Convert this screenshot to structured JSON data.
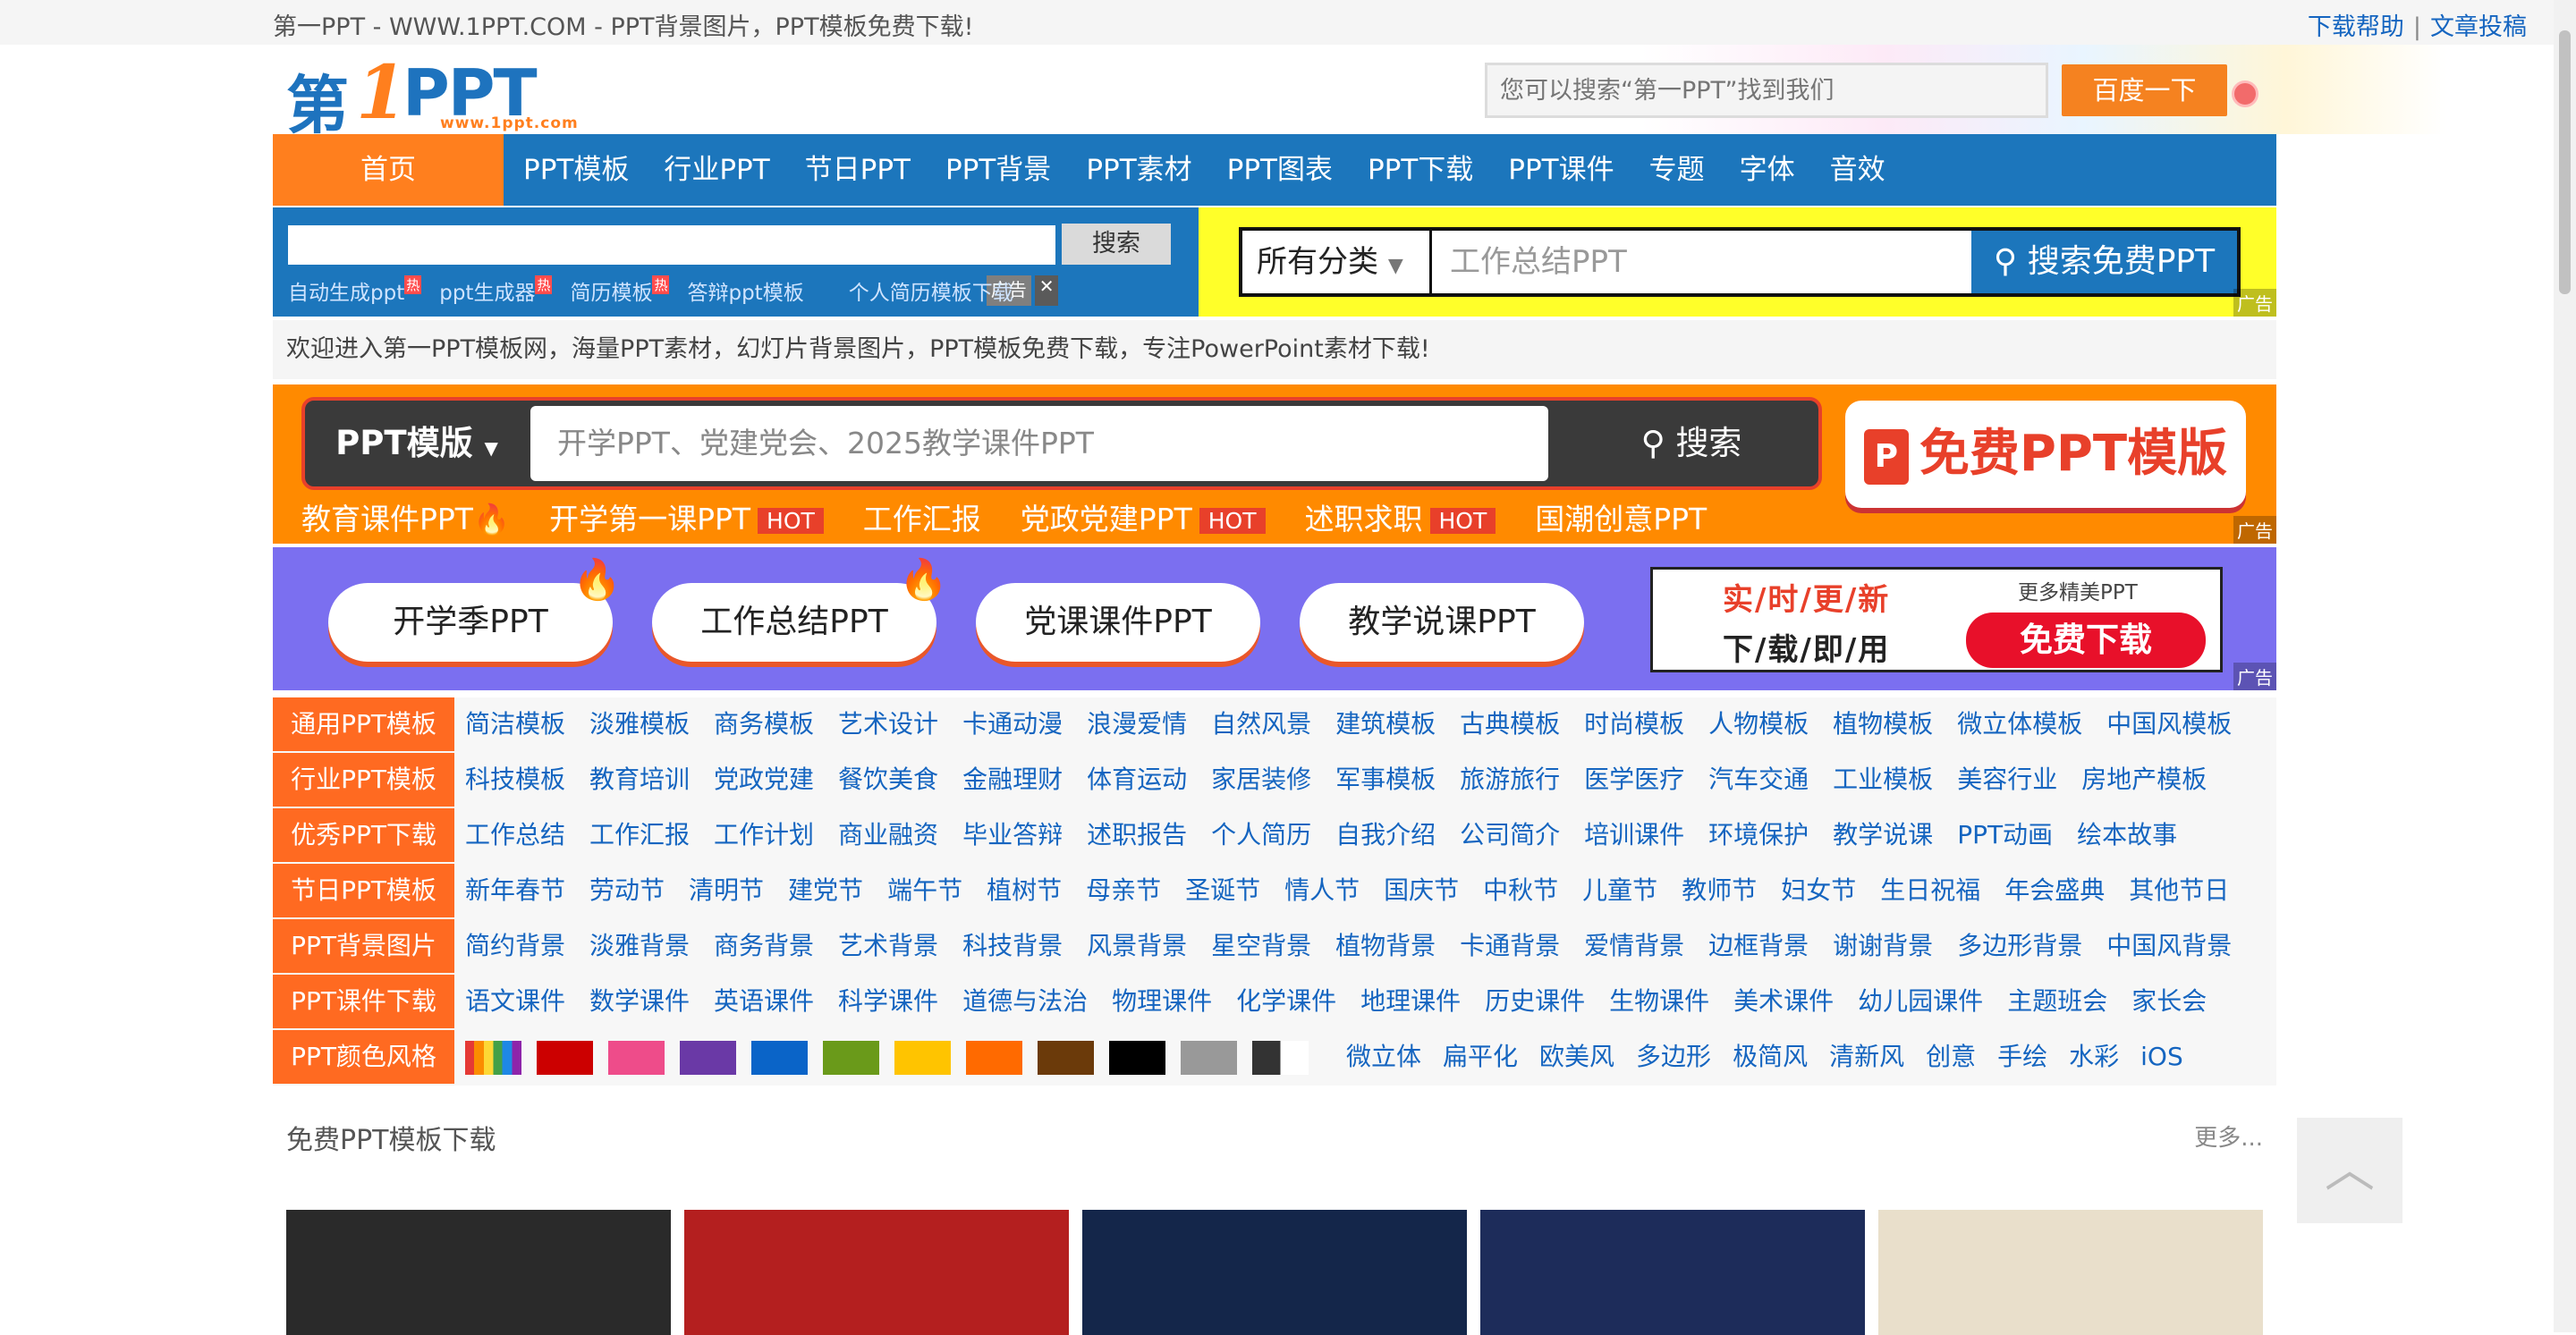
{
  "topbar": {
    "title": "第一PPT - WWW.1PPT.COM - PPT背景图片，PPT模板免费下载!",
    "links": [
      "下载帮助",
      "文章投稿"
    ],
    "separator": "|"
  },
  "logo": {
    "di": "第",
    "one": "1",
    "ppt": "PPT",
    "url": "www.1ppt.com"
  },
  "header_search": {
    "placeholder": "您可以搜索“第一PPT”找到我们",
    "button": "百度一下"
  },
  "nav": {
    "home": "首页",
    "items": [
      "PPT模板",
      "行业PPT",
      "节日PPT",
      "PPT背景",
      "PPT素材",
      "PPT图表",
      "PPT下载",
      "PPT课件",
      "专题",
      "字体",
      "音效"
    ]
  },
  "site_search": {
    "button": "搜索",
    "hot_links": [
      {
        "label": "自动生成ppt",
        "badge": "热"
      },
      {
        "label": "ppt生成器",
        "badge": "热"
      },
      {
        "label": "简历模板",
        "badge": "热"
      },
      {
        "label": "答辩ppt模板",
        "badge": ""
      },
      {
        "label": "个人简历模板下载",
        "badge": ""
      }
    ],
    "ad_label": "广告",
    "ad_close": "✕"
  },
  "yellow_search": {
    "category": "所有分类",
    "placeholder": "工作总结PPT",
    "button": "搜索免费PPT",
    "ad": "广告"
  },
  "welcome": "欢迎进入第一PPT模板网，海量PPT素材，幻灯片背景图片，PPT模板免费下载，专注PowerPoint素材下载!",
  "banner1": {
    "category": "PPT模版",
    "placeholder": "开学PPT、党建党会、2025教学课件PPT",
    "button": "搜索",
    "free_button": "免费PPT模版",
    "tags": [
      {
        "label": "教育课件PPT",
        "badge": ""
      },
      {
        "label": "开学第一课PPT",
        "badge": "HOT"
      },
      {
        "label": "工作汇报",
        "badge": ""
      },
      {
        "label": "党政党建PPT",
        "badge": "HOT"
      },
      {
        "label": "述职求职",
        "badge": "HOT"
      },
      {
        "label": "国潮创意PPT",
        "badge": ""
      }
    ],
    "ad": "广告"
  },
  "banner2": {
    "pills": [
      "开学季PPT",
      "工作总结PPT",
      "党课课件PPT",
      "教学说课PPT"
    ],
    "ad_line1": "实/时/更/新",
    "ad_line2": "下/载/即/用",
    "ad_line3": "更多精美PPT",
    "ad_button": "免费下载",
    "ad": "广告"
  },
  "categories": [
    {
      "label": "通用PPT模板",
      "links": [
        "简洁模板",
        "淡雅模板",
        "商务模板",
        "艺术设计",
        "卡通动漫",
        "浪漫爱情",
        "自然风景",
        "建筑模板",
        "古典模板",
        "时尚模板",
        "人物模板",
        "植物模板",
        "微立体模板",
        "中国风模板"
      ]
    },
    {
      "label": "行业PPT模板",
      "links": [
        "科技模板",
        "教育培训",
        "党政党建",
        "餐饮美食",
        "金融理财",
        "体育运动",
        "家居装修",
        "军事模板",
        "旅游旅行",
        "医学医疗",
        "汽车交通",
        "工业模板",
        "美容行业",
        "房地产模板"
      ]
    },
    {
      "label": "优秀PPT下载",
      "links": [
        "工作总结",
        "工作汇报",
        "工作计划",
        "商业融资",
        "毕业答辩",
        "述职报告",
        "个人简历",
        "自我介绍",
        "公司简介",
        "培训课件",
        "环境保护",
        "教学说课",
        "PPT动画",
        "绘本故事"
      ]
    },
    {
      "label": "节日PPT模板",
      "links": [
        "新年春节",
        "劳动节",
        "清明节",
        "建党节",
        "端午节",
        "植树节",
        "母亲节",
        "圣诞节",
        "情人节",
        "国庆节",
        "中秋节",
        "儿童节",
        "教师节",
        "妇女节",
        "生日祝福",
        "年会盛典",
        "其他节日"
      ]
    },
    {
      "label": "PPT背景图片",
      "links": [
        "简约背景",
        "淡雅背景",
        "商务背景",
        "艺术背景",
        "科技背景",
        "风景背景",
        "星空背景",
        "植物背景",
        "卡通背景",
        "爱情背景",
        "边框背景",
        "谢谢背景",
        "多边形背景",
        "中国风背景"
      ]
    },
    {
      "label": "PPT课件下载",
      "links": [
        "语文课件",
        "数学课件",
        "英语课件",
        "科学课件",
        "道德与法治",
        "物理课件",
        "化学课件",
        "地理课件",
        "历史课件",
        "生物课件",
        "美术课件",
        "幼儿园课件",
        "主题班会",
        "家长会"
      ]
    }
  ],
  "color_style": {
    "label": "PPT颜色风格",
    "colors": [
      "#cc0000",
      "#ee4c8a",
      "#6a39a6",
      "#0a64c8",
      "#6a9a1a",
      "#ffc400",
      "#ff6a00",
      "#6b3a0a",
      "#000000",
      "#999999"
    ],
    "styles": [
      "微立体",
      "扁平化",
      "欧美风",
      "多边形",
      "极简风",
      "清新风",
      "创意",
      "手绘",
      "水彩",
      "iOS"
    ]
  },
  "section": {
    "title": "免费PPT模板下载",
    "more": "更多..."
  },
  "cards": [
    {
      "name": "fashion-template",
      "color": "#2a2a2a"
    },
    {
      "name": "guochao-template",
      "color": "#b41f1f"
    },
    {
      "name": "minguo-jiyi-template",
      "color": "#14264a"
    },
    {
      "name": "minguo-fan-template",
      "color": "#1d2c5a"
    },
    {
      "name": "minguo-memory-template",
      "color": "#e9dfcb"
    }
  ],
  "totop_icon": "chevron-up-icon"
}
